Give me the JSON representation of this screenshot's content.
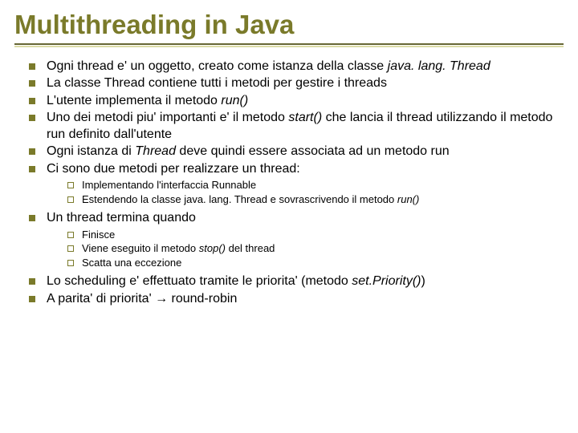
{
  "title": "Multithreading in Java",
  "bullets": {
    "b1a": "Ogni thread e' un oggetto, creato come istanza della classe ",
    "b1b": "java. lang. Thread",
    "b2": "La classe Thread contiene tutti i metodi per gestire i threads",
    "b3a": "L'utente implementa il metodo ",
    "b3b": "run()",
    "b4a": "Uno dei metodi piu' importanti e' il metodo ",
    "b4b": "start()",
    "b4c": " che lancia il thread utilizzando il metodo run definito dall'utente",
    "b5a": "Ogni istanza di ",
    "b5b": "Thread",
    "b5c": " deve quindi essere associata ad un metodo run",
    "b6": "Ci sono due metodi per realizzare un thread:",
    "b7": "Un thread termina quando",
    "b8a": "Lo scheduling e' effettuato tramite le priorita' (metodo ",
    "b8b": "set.Priority()",
    "b8c": ")",
    "b9a": "A parita' di priorita' ",
    "b9arrow": "→",
    "b9b": " round-robin"
  },
  "sub1": {
    "s1": "Implementando l'interfaccia Runnable",
    "s2a": "Estendendo la classe java. lang. Thread e sovrascrivendo il metodo ",
    "s2b": "run()"
  },
  "sub2": {
    "s1": "Finisce",
    "s2a": "Viene eseguito il metodo ",
    "s2b": "stop()",
    "s2c": " del thread",
    "s3": "Scatta una eccezione"
  }
}
